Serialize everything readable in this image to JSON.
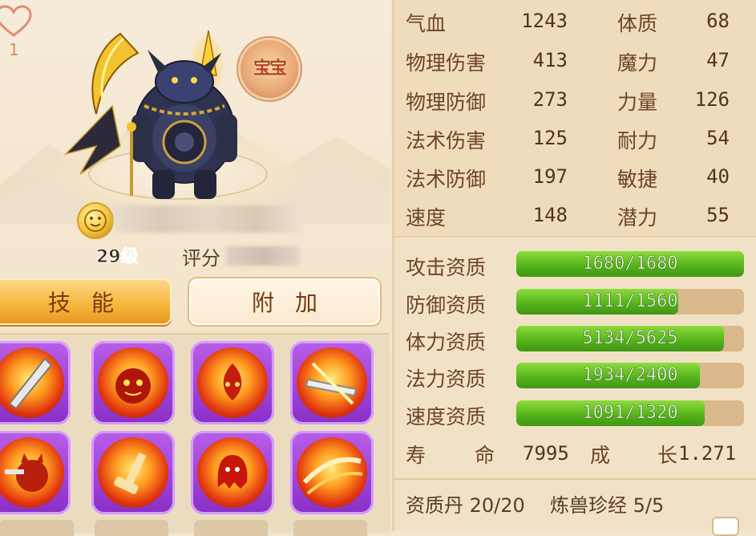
{
  "pet": {
    "like_count": "1",
    "badge_label": "宝宝",
    "level": "29级",
    "score_label": "评分"
  },
  "buttons": {
    "skills": "技能",
    "extra": "附加"
  },
  "skills": [
    {
      "icon": "sword-slash-icon"
    },
    {
      "icon": "fire-demon-face-icon"
    },
    {
      "icon": "flame-imp-icon"
    },
    {
      "icon": "blade-strike-icon"
    },
    {
      "icon": "cat-warrior-icon"
    },
    {
      "icon": "hammer-blast-icon"
    },
    {
      "icon": "fire-ghost-icon"
    },
    {
      "icon": "crimson-slash-icon"
    }
  ],
  "stats": [
    {
      "name": "气血",
      "value": "1243"
    },
    {
      "name": "物理伤害",
      "value": "413"
    },
    {
      "name": "物理防御",
      "value": "273"
    },
    {
      "name": "法术伤害",
      "value": "125"
    },
    {
      "name": "法术防御",
      "value": "197"
    },
    {
      "name": "速度",
      "value": "148"
    }
  ],
  "attributes": [
    {
      "name": "体质",
      "value": "68"
    },
    {
      "name": "魔力",
      "value": "47"
    },
    {
      "name": "力量",
      "value": "126"
    },
    {
      "name": "耐力",
      "value": "54"
    },
    {
      "name": "敏捷",
      "value": "40"
    },
    {
      "name": "潜力",
      "value": "55"
    }
  ],
  "aptitudes": [
    {
      "name": "攻击资质",
      "current": 1680,
      "max": 1680,
      "text": "1680/1680"
    },
    {
      "name": "防御资质",
      "current": 1111,
      "max": 1560,
      "text": "1111/1560"
    },
    {
      "name": "体力资质",
      "current": 5134,
      "max": 5625,
      "text": "5134/5625"
    },
    {
      "name": "法力资质",
      "current": 1934,
      "max": 2400,
      "text": "1934/2400"
    },
    {
      "name": "速度资质",
      "current": 1091,
      "max": 1320,
      "text": "1091/1320"
    }
  ],
  "life": {
    "label_a": "寿",
    "label_b": "命",
    "value": "7995",
    "growth_a": "成",
    "growth_b": "长",
    "growth_value": "1.271"
  },
  "items": {
    "pill": "资质丹 20/20",
    "manual": "炼兽珍经 5/5"
  },
  "colors": {
    "bar_fill": "#56b51c",
    "bar_track": "#d9b98b",
    "skill_frame": "#8a2fc7",
    "skill_button": "#f7b43a"
  }
}
